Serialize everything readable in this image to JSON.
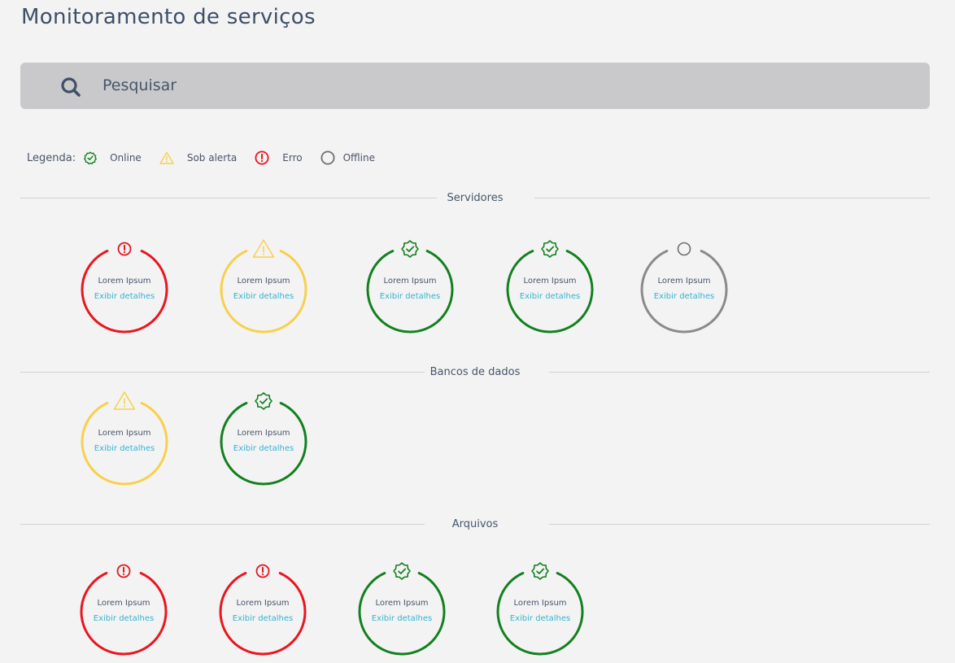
{
  "page": {
    "title": "Monitoramento de serviços"
  },
  "search": {
    "placeholder": "Pesquisar",
    "value": ""
  },
  "colors": {
    "online": "#13801f",
    "alerta": "#f9cf4c",
    "erro": "#e8161f",
    "offline": "#8a8a8a",
    "link": "#35b3d0"
  },
  "legend": {
    "label": "Legenda:",
    "items": [
      {
        "status": "online",
        "icon": "badge-check-icon",
        "label": "Online"
      },
      {
        "status": "alerta",
        "icon": "warning-triangle-icon",
        "label": "Sob alerta"
      },
      {
        "status": "erro",
        "icon": "error-circle-icon",
        "label": "Erro"
      },
      {
        "status": "offline",
        "icon": "offline-circle-icon",
        "label": "Offline"
      }
    ]
  },
  "sections": [
    {
      "title": "Servidores",
      "services": [
        {
          "name": "Lorem Ipsum",
          "link": "Exibir detalhes",
          "status": "erro"
        },
        {
          "name": "Lorem Ipsum",
          "link": "Exibir detalhes",
          "status": "alerta"
        },
        {
          "name": "Lorem Ipsum",
          "link": "Exibir detalhes",
          "status": "online"
        },
        {
          "name": "Lorem Ipsum",
          "link": "Exibir detalhes",
          "status": "online"
        },
        {
          "name": "Lorem Ipsum",
          "link": "Exibir detalhes",
          "status": "offline"
        }
      ]
    },
    {
      "title": "Bancos de dados",
      "services": [
        {
          "name": "Lorem Ipsum",
          "link": "Exibir detalhes",
          "status": "alerta"
        },
        {
          "name": "Lorem Ipsum",
          "link": "Exibir detalhes",
          "status": "online"
        }
      ]
    },
    {
      "title": "Arquivos",
      "services": [
        {
          "name": "Lorem Ipsum",
          "link": "Exibir detalhes",
          "status": "erro"
        },
        {
          "name": "Lorem Ipsum",
          "link": "Exibir detalhes",
          "status": "erro"
        },
        {
          "name": "Lorem Ipsum",
          "link": "Exibir detalhes",
          "status": "online"
        },
        {
          "name": "Lorem Ipsum",
          "link": "Exibir detalhes",
          "status": "online"
        }
      ]
    }
  ]
}
